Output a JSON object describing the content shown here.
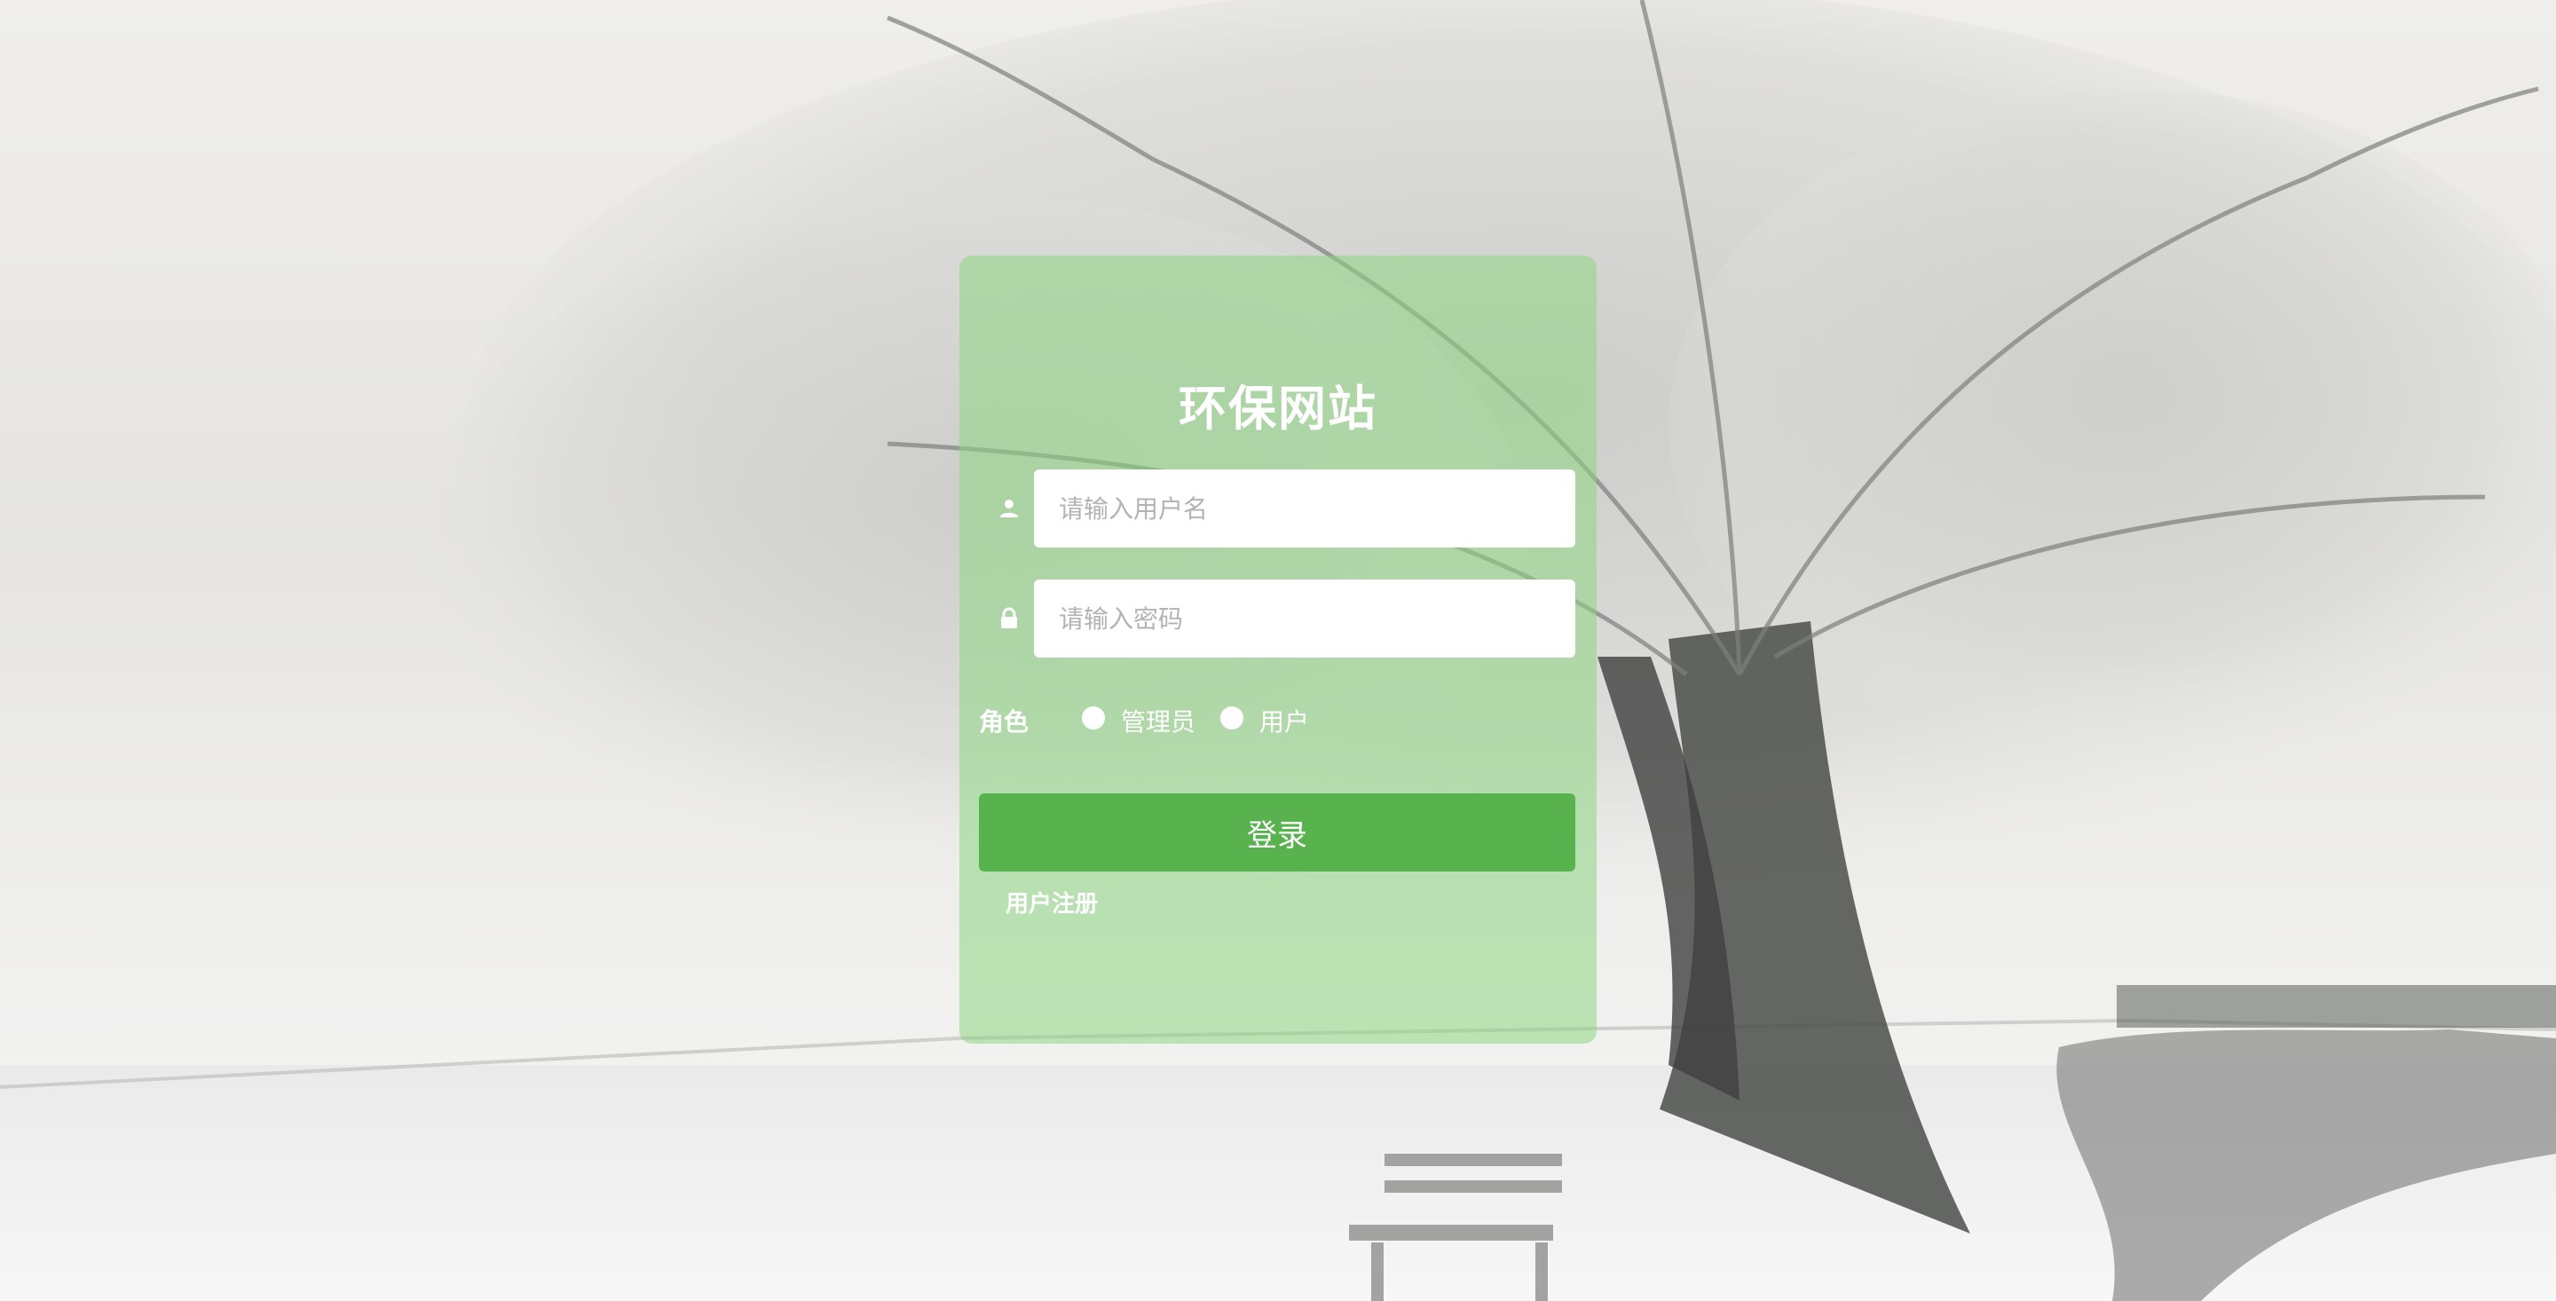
{
  "login": {
    "title": "环保网站",
    "username_placeholder": "请输入用户名",
    "password_placeholder": "请输入密码",
    "role_label": "角色",
    "role_options": [
      "管理员",
      "用户"
    ],
    "login_button": "登录",
    "register_link": "用户注册"
  },
  "icons": {
    "username": "user-icon",
    "password": "lock-icon"
  },
  "colors": {
    "panel": "#8cd682",
    "button": "#58b24d",
    "text": "#ffffff"
  }
}
